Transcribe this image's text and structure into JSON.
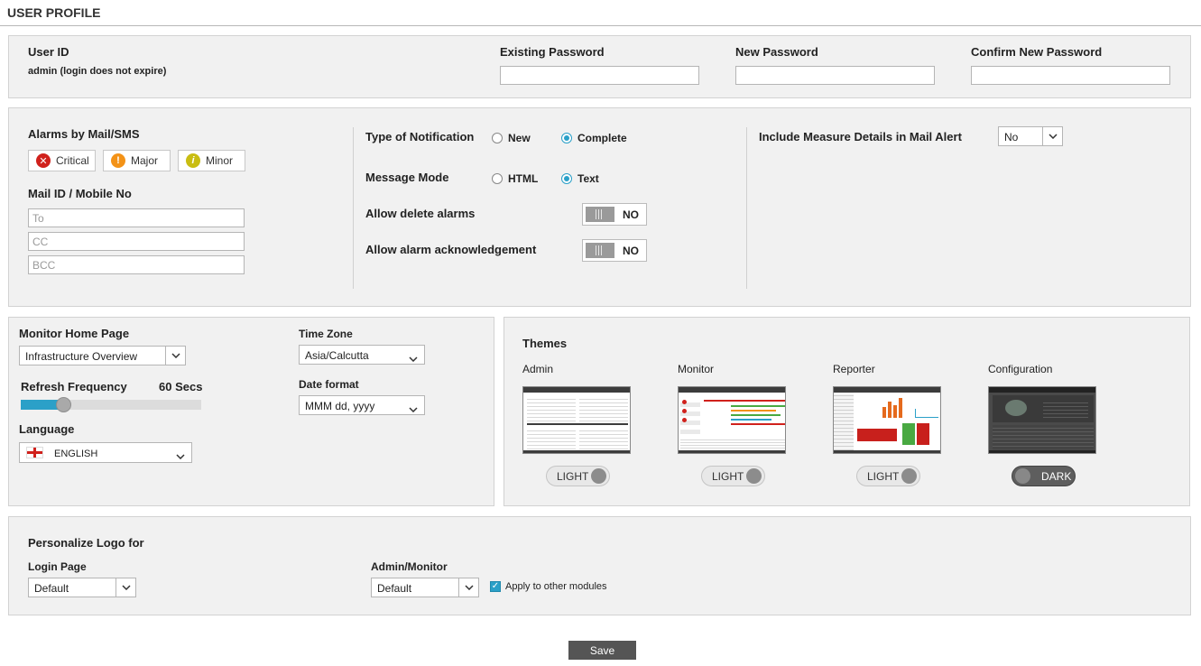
{
  "page": {
    "title": "USER PROFILE"
  },
  "account": {
    "user_id_label": "User ID",
    "user_id_value": "admin (login does not expire)",
    "existing_password_label": "Existing Password",
    "new_password_label": "New Password",
    "confirm_password_label": "Confirm New Password"
  },
  "alarms": {
    "title": "Alarms by Mail/SMS",
    "severities": [
      {
        "label": "Critical",
        "glyph": "✕",
        "color": "#d0211c",
        "icon": "critical-icon"
      },
      {
        "label": "Major",
        "glyph": "!",
        "color": "#f39217",
        "icon": "major-icon"
      },
      {
        "label": "Minor",
        "glyph": "i",
        "color": "#c9bd12",
        "icon": "minor-icon"
      }
    ],
    "mail_label": "Mail ID / Mobile No",
    "to_placeholder": "To",
    "cc_placeholder": "CC",
    "bcc_placeholder": "BCC"
  },
  "notification": {
    "type_label": "Type of Notification",
    "type_options": [
      "New",
      "Complete"
    ],
    "type_selected": "Complete",
    "mode_label": "Message Mode",
    "mode_options": [
      "HTML",
      "Text"
    ],
    "mode_selected": "Text",
    "delete_label": "Allow delete alarms",
    "delete_value": "NO",
    "ack_label": "Allow alarm acknowledgement",
    "ack_value": "NO"
  },
  "measure": {
    "label": "Include Measure Details in Mail Alert",
    "value": "No"
  },
  "monitor": {
    "home_label": "Monitor Home Page",
    "home_value": "Infrastructure Overview",
    "refresh_label": "Refresh Frequency",
    "refresh_value": "60 Secs",
    "refresh_fraction": 0.235,
    "language_label": "Language",
    "language_value": "ENGLISH",
    "timezone_label": "Time Zone",
    "timezone_value": "Asia/Calcutta",
    "date_label": "Date format",
    "date_value": "MMM dd, yyyy"
  },
  "themes": {
    "title": "Themes",
    "items": [
      {
        "name": "Admin",
        "mode": "LIGHT"
      },
      {
        "name": "Monitor",
        "mode": "LIGHT"
      },
      {
        "name": "Reporter",
        "mode": "LIGHT"
      },
      {
        "name": "Configuration",
        "mode": "DARK"
      }
    ]
  },
  "logo": {
    "title": "Personalize Logo for",
    "login_label": "Login Page",
    "login_value": "Default",
    "admin_label": "Admin/Monitor",
    "admin_value": "Default",
    "apply_label": "Apply to other modules",
    "apply_checked": true
  },
  "footer": {
    "save_label": "Save"
  }
}
